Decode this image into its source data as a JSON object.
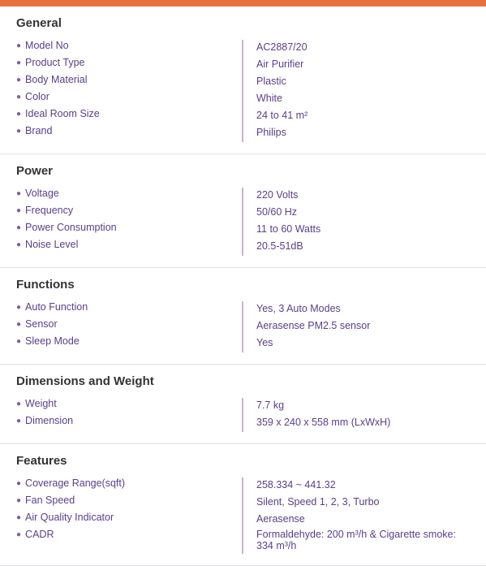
{
  "topBar": {
    "color": "#e87040"
  },
  "sections": [
    {
      "id": "general",
      "title": "General",
      "rows": [
        {
          "label": "Model No",
          "value": "AC2887/20"
        },
        {
          "label": "Product Type",
          "value": "Air Purifier"
        },
        {
          "label": "Body Material",
          "value": "Plastic"
        },
        {
          "label": "Color",
          "value": "White"
        },
        {
          "label": "Ideal Room Size",
          "value": "24 to 41 m²"
        },
        {
          "label": "Brand",
          "value": "Philips"
        }
      ]
    },
    {
      "id": "power",
      "title": "Power",
      "rows": [
        {
          "label": "Voltage",
          "value": "220 Volts"
        },
        {
          "label": "Frequency",
          "value": "50/60 Hz"
        },
        {
          "label": "Power Consumption",
          "value": "11 to 60 Watts"
        },
        {
          "label": "Noise Level",
          "value": "20.5-51dB"
        }
      ]
    },
    {
      "id": "functions",
      "title": "Functions",
      "rows": [
        {
          "label": "Auto Function",
          "value": "Yes, 3 Auto Modes"
        },
        {
          "label": "Sensor",
          "value": "Aerasense PM2.5 sensor"
        },
        {
          "label": "Sleep Mode",
          "value": "Yes"
        }
      ]
    },
    {
      "id": "dimensions",
      "title": "Dimensions and Weight",
      "rows": [
        {
          "label": "Weight",
          "value": "7.7 kg"
        },
        {
          "label": "Dimension",
          "value": "359 x 240 x 558 mm (LxWxH)"
        }
      ]
    },
    {
      "id": "features",
      "title": "Features",
      "rows": [
        {
          "label": "Coverage Range(sqft)",
          "value": "258.334 ~ 441.32"
        },
        {
          "label": "Fan Speed",
          "value": "Silent, Speed 1, 2, 3, Turbo"
        },
        {
          "label": "Air Quality Indicator",
          "value": "Aerasense"
        },
        {
          "label": "CADR",
          "value": "Formaldehyde: 200 m³/h & Cigarette smoke: 334 m³/h"
        }
      ]
    }
  ]
}
